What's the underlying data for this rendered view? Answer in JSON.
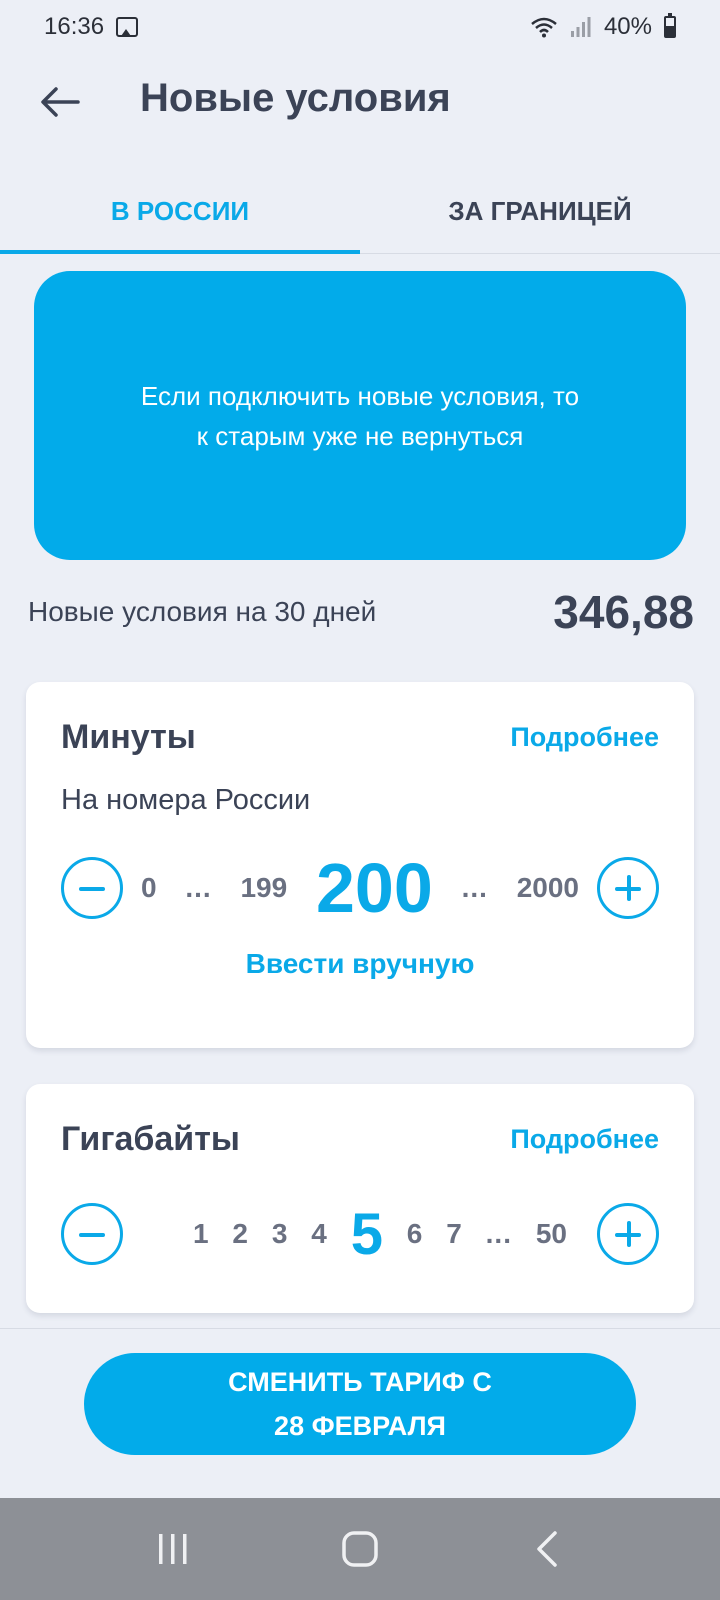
{
  "status_bar": {
    "time": "16:36",
    "battery": "40%"
  },
  "header": {
    "title": "Новые условия"
  },
  "tabs": [
    {
      "label": "В РОССИИ",
      "active": true
    },
    {
      "label": "ЗА ГРАНИЦЕЙ",
      "active": false
    }
  ],
  "banner": {
    "line1": "Если подключить новые условия, то",
    "line2": "к старым уже не вернуться"
  },
  "price": {
    "label": "Новые условия на 30 дней",
    "value": "346,88"
  },
  "minutes": {
    "title": "Минуты",
    "more": "Подробнее",
    "subtitle": "На номера России",
    "scale_min": "0",
    "scale_prev": "199",
    "selected": "200",
    "scale_max": "2000",
    "dots": "...",
    "manual": "Ввести вручную"
  },
  "gigabytes": {
    "title": "Гигабайты",
    "more": "Подробнее",
    "values_before": [
      "1",
      "2",
      "3",
      "4"
    ],
    "selected": "5",
    "values_after": [
      "6",
      "7"
    ],
    "dots": "...",
    "scale_max": "50"
  },
  "cta": {
    "line1": "СМЕНИТЬ ТАРИФ С",
    "line2": "28 ФЕВРАЛЯ"
  },
  "colors": {
    "accent": "#0aa9e8",
    "banner": "#02abea",
    "text": "#3b4356",
    "background": "#eceff6"
  }
}
